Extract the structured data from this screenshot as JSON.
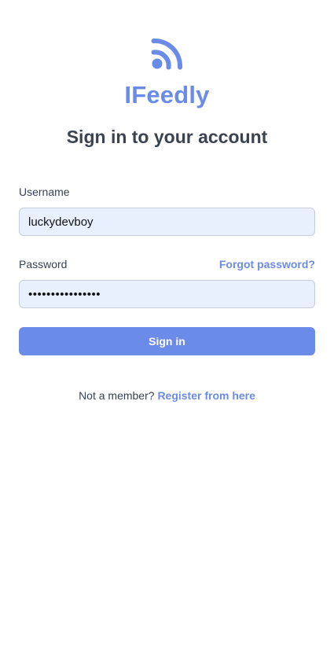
{
  "brand": {
    "name": "IFeedly",
    "logo_icon": "rss-icon",
    "color": "#6b8be8"
  },
  "page": {
    "heading": "Sign in to your account"
  },
  "form": {
    "username_label": "Username",
    "username_value": "luckydevboy",
    "password_label": "Password",
    "password_value": "••••••••••••••••",
    "forgot_password_label": "Forgot password?",
    "submit_label": "Sign in"
  },
  "footer": {
    "prompt": "Not a member?",
    "register_link": "Register from here"
  },
  "colors": {
    "accent": "#6b8be8",
    "input_bg": "#e8f0fe",
    "text": "#374151"
  }
}
